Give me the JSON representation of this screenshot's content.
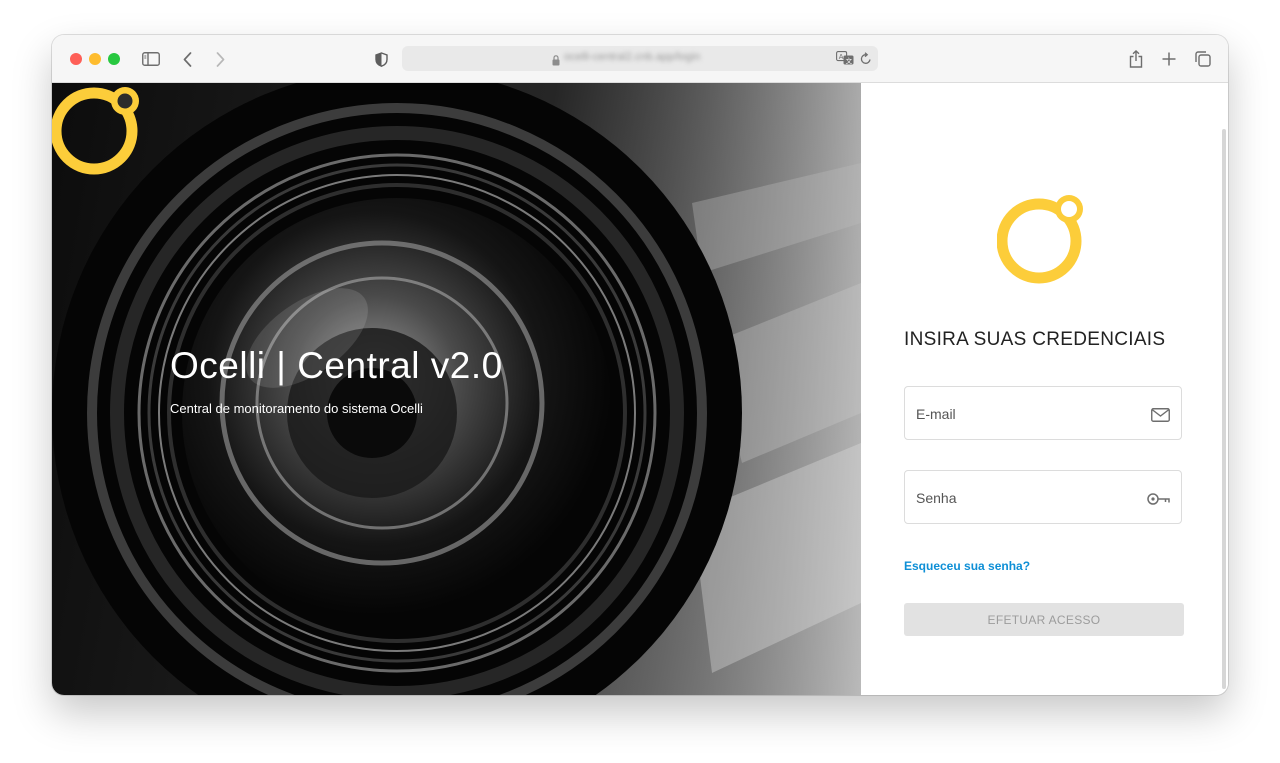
{
  "browser": {
    "url": "ocelli-central2.cnb.app/login",
    "icons": [
      "sidebar-icon",
      "back-icon",
      "forward-icon",
      "shield-icon",
      "lock-icon",
      "translate-icon",
      "reload-icon",
      "share-icon",
      "new-tab-icon",
      "tabs-overview-icon"
    ]
  },
  "hero": {
    "title": "Ocelli | Central v2.0",
    "subtitle": "Central de monitoramento do sistema Ocelli",
    "logo_icon": "ocelli-logo-icon"
  },
  "login": {
    "heading": "INSIRA SUAS CREDENCIAIS",
    "email": {
      "placeholder": "E-mail",
      "value": "",
      "icon": "envelope-icon"
    },
    "password": {
      "placeholder": "Senha",
      "value": "",
      "icon": "key-icon"
    },
    "forgot_link": "Esqueceu sua senha?",
    "submit_label": "EFETUAR ACESSO"
  },
  "colors": {
    "brand_yellow": "#fccd3a",
    "link_blue": "#0e8fd6",
    "button_disabled_bg": "#e2e2e2",
    "button_disabled_text": "#9c9c9c"
  }
}
